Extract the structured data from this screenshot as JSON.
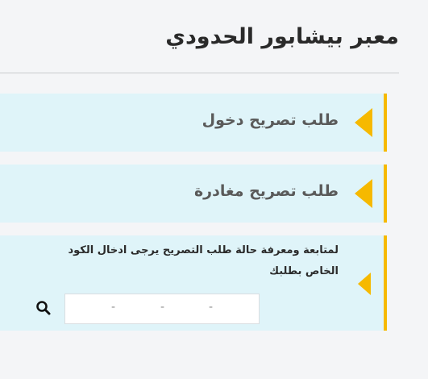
{
  "page": {
    "title": "معبر بيشابور الحدودي"
  },
  "cards": {
    "entry": {
      "label": "طلب تصريح دخول",
      "icon": "chevron-left-triangle-icon"
    },
    "exit": {
      "label": "طلب تصريح مغادرة",
      "icon": "chevron-left-triangle-icon"
    },
    "track": {
      "text": "لمتابعة ومعرفة حالة طلب التصريح يرجى ادخال الكود الخاص بطلبك",
      "icon": "chevron-left-triangle-icon",
      "code_input": {
        "value": "",
        "separators": [
          "-",
          "-",
          "-"
        ]
      },
      "search_icon": "search-icon"
    }
  },
  "colors": {
    "accent": "#f6b900",
    "card_bg": "#dff4f9",
    "page_bg": "#f4f5f7",
    "title": "#2a2a2a",
    "label": "#5a5a5a"
  }
}
